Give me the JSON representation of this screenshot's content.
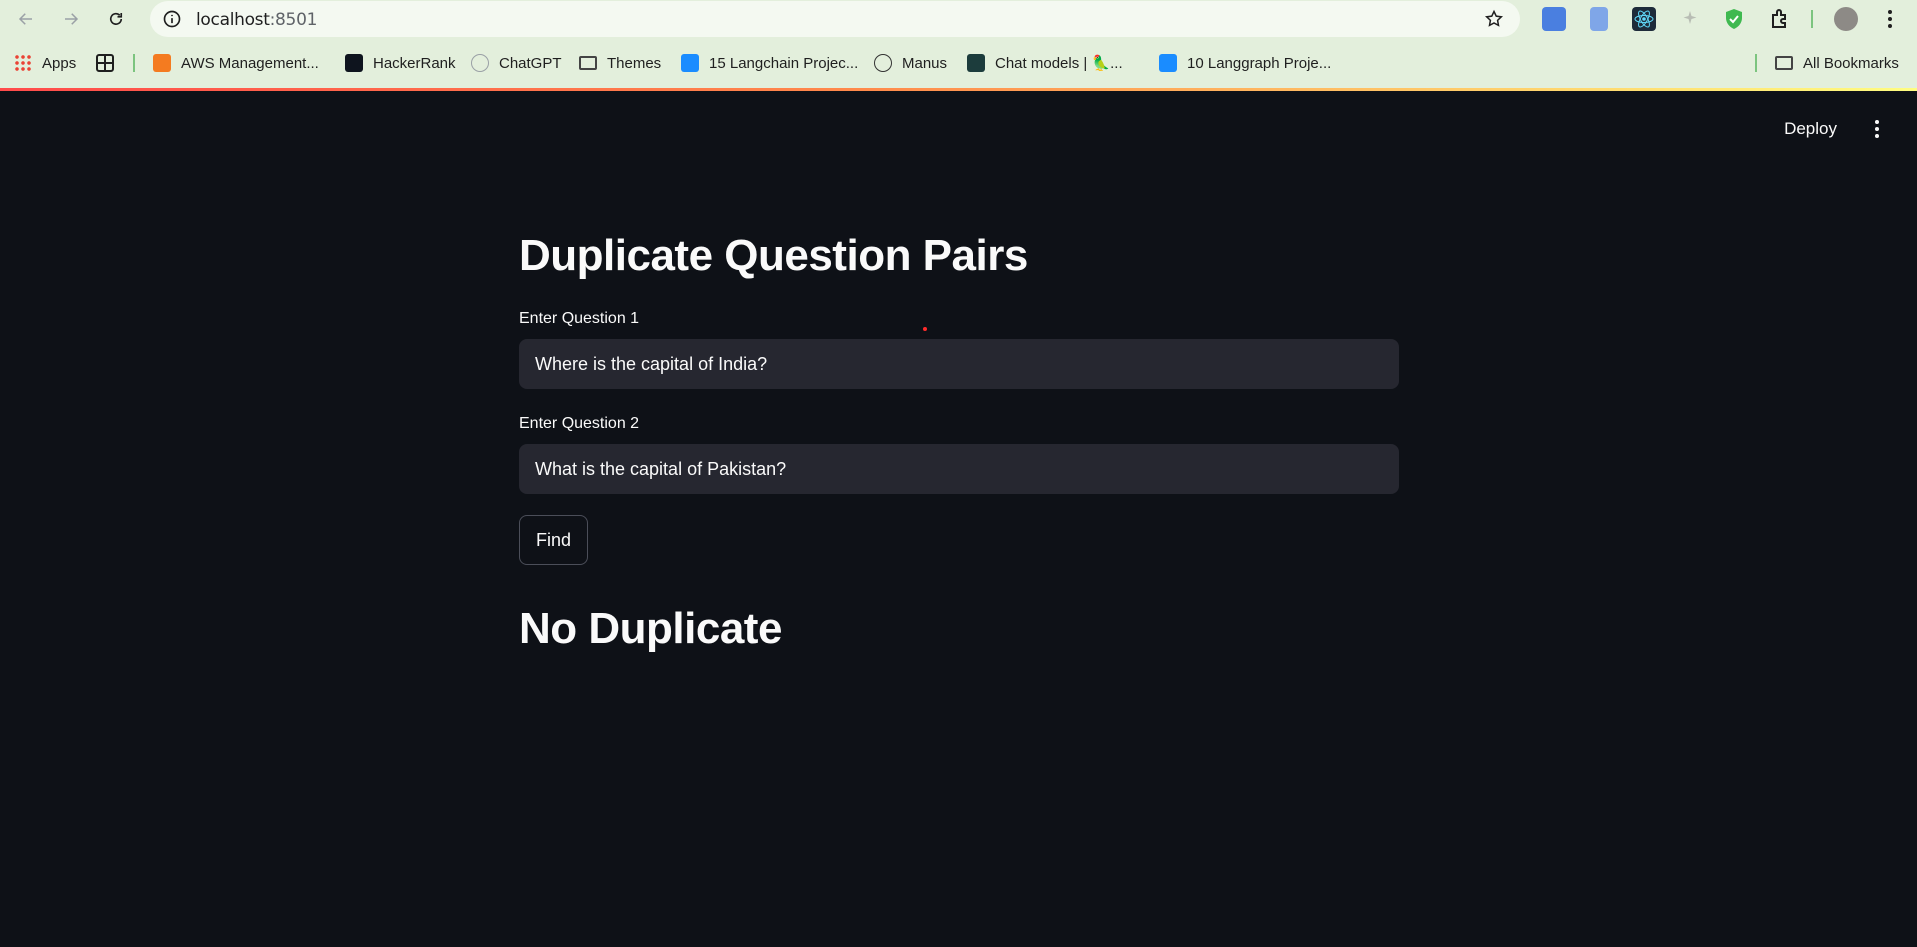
{
  "browser": {
    "url_host": "localhost",
    "url_port": ":8501",
    "bookmarks": [
      {
        "label": "Apps",
        "icon": "apps-grid-icon"
      },
      {
        "label": "",
        "icon": "grid-icon"
      },
      {
        "label": "AWS Management...",
        "icon": "aws-icon"
      },
      {
        "label": "HackerRank",
        "icon": "hackerrank-icon"
      },
      {
        "label": "ChatGPT",
        "icon": "chatgpt-icon"
      },
      {
        "label": "Themes",
        "icon": "folder-icon"
      },
      {
        "label": "15 Langchain Projec...",
        "icon": "pp-icon"
      },
      {
        "label": "Manus",
        "icon": "manus-icon"
      },
      {
        "label": "Chat models | 🦜...",
        "icon": "chat-models-icon"
      },
      {
        "label": "10 Langgraph Proje...",
        "icon": "pp-icon"
      },
      {
        "label": "All Bookmarks",
        "icon": "folder-icon"
      }
    ]
  },
  "app": {
    "deploy_label": "Deploy",
    "title": "Duplicate Question Pairs",
    "q1_label": "Enter Question 1",
    "q1_value": "Where is the capital of India?",
    "q2_label": "Enter Question 2",
    "q2_value": "What is the capital of Pakistan?",
    "find_label": "Find",
    "result": "No Duplicate"
  },
  "colors": {
    "background": "#0e1117",
    "input_bg": "#262730",
    "text": "#fafafa",
    "chrome": "#e3efdc"
  }
}
